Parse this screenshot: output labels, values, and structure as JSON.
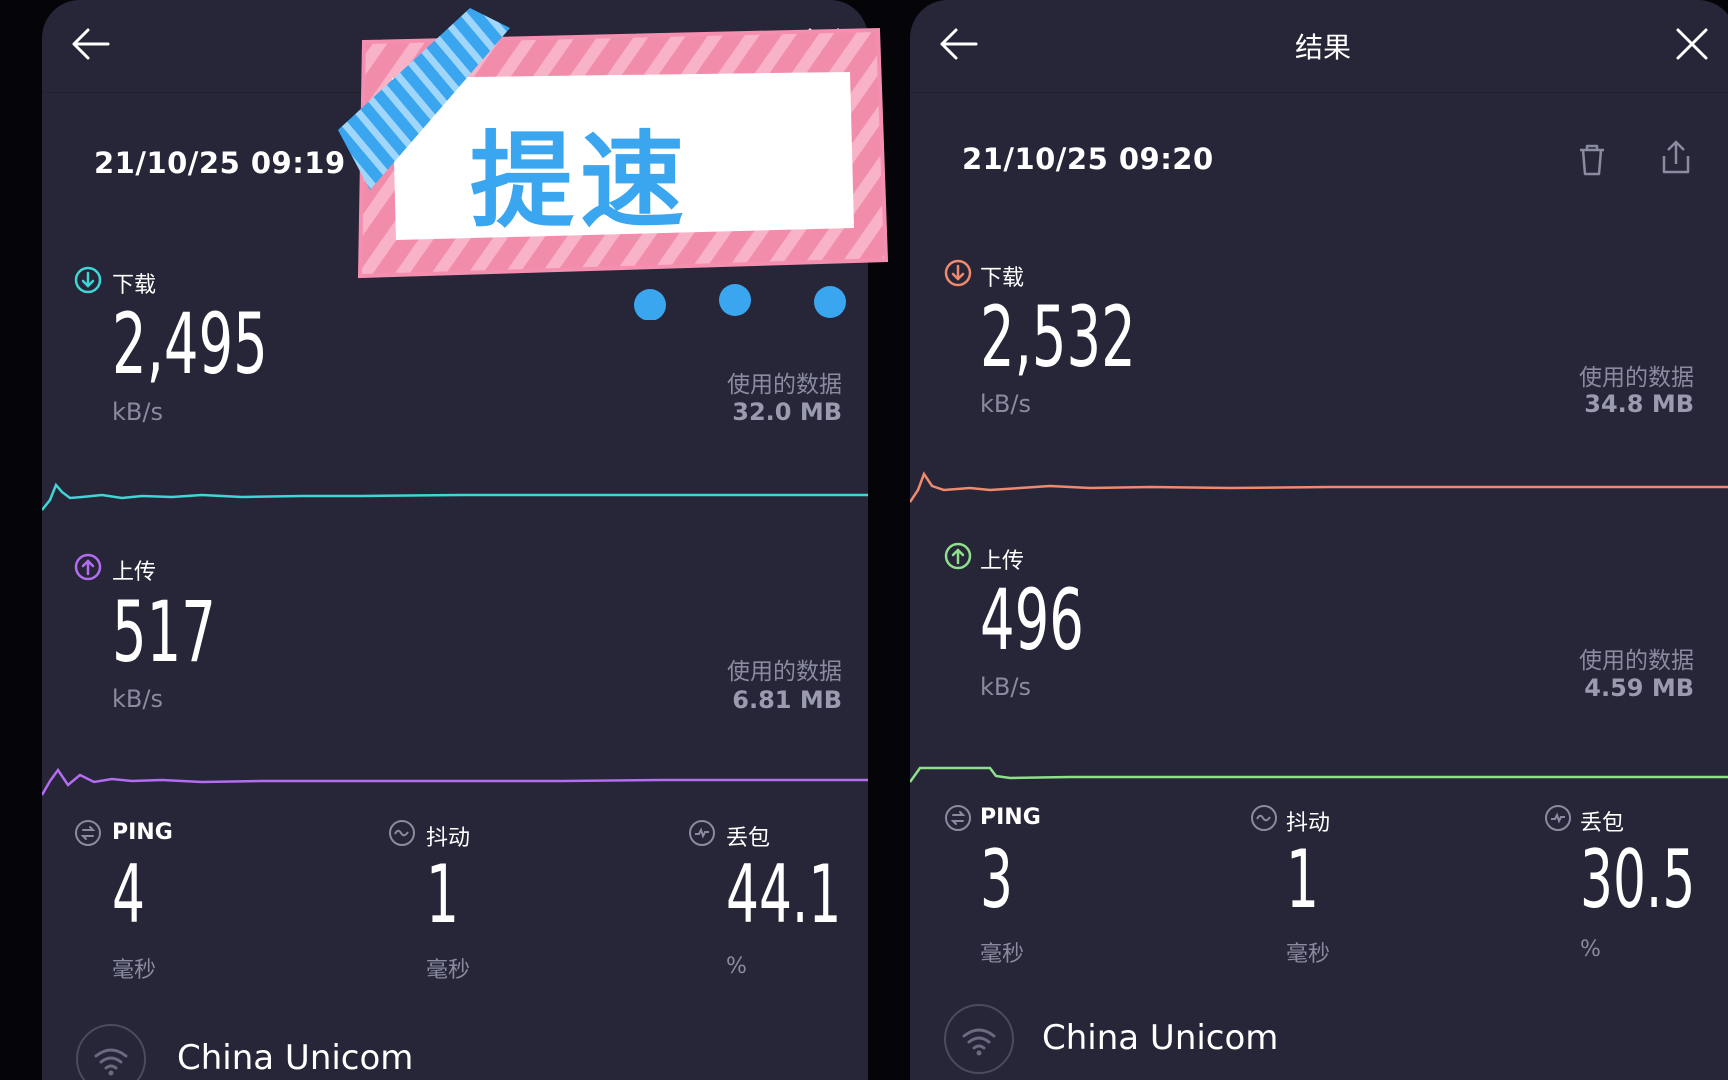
{
  "left": {
    "title": "",
    "datetime": "21/10/25 09:19",
    "download": {
      "label": "下载",
      "value": "2,495",
      "unit": "kB/s",
      "used_label": "使用的数据",
      "used_value": "32.0 MB"
    },
    "upload": {
      "label": "上传",
      "value": "517",
      "unit": "kB/s",
      "used_label": "使用的数据",
      "used_value": "6.81 MB"
    },
    "ping": {
      "label": "PING",
      "value": "4",
      "unit": "毫秒"
    },
    "jitter": {
      "label": "抖动",
      "value": "1",
      "unit": "毫秒"
    },
    "loss": {
      "label": "丢包",
      "value": "44.1",
      "unit": "%"
    },
    "isp": "China Unicom"
  },
  "right": {
    "title": "结果",
    "datetime": "21/10/25 09:20",
    "download": {
      "label": "下载",
      "value": "2,532",
      "unit": "kB/s",
      "used_label": "使用的数据",
      "used_value": "34.8 MB"
    },
    "upload": {
      "label": "上传",
      "value": "496",
      "unit": "kB/s",
      "used_label": "使用的数据",
      "used_value": "4.59 MB"
    },
    "ping": {
      "label": "PING",
      "value": "3",
      "unit": "毫秒"
    },
    "jitter": {
      "label": "抖动",
      "value": "1",
      "unit": "毫秒"
    },
    "loss": {
      "label": "丢包",
      "value": "30.5",
      "unit": "%"
    },
    "isp": "China Unicom"
  },
  "sticker": {
    "text": "提速"
  },
  "colors": {
    "background": "#262638",
    "left_download": "#3fd6d6",
    "left_upload": "#b46cf0",
    "right_download": "#f08a6c",
    "right_upload": "#8fe08a",
    "sticker_pink": "#f28cab",
    "sticker_blue": "#3aa6f0"
  },
  "icons": [
    "back-arrow-icon",
    "close-icon",
    "trash-icon",
    "share-icon",
    "download-arrow-icon",
    "upload-arrow-icon",
    "ping-icon",
    "jitter-icon",
    "packet-loss-icon",
    "wifi-icon"
  ]
}
